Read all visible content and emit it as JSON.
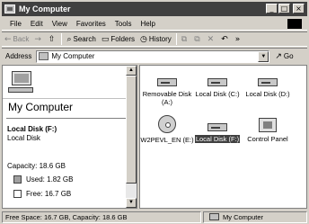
{
  "window": {
    "title": "My Computer"
  },
  "titlebar_buttons": {
    "minimize": "_",
    "maximize": "□",
    "close": "×"
  },
  "menu": [
    "File",
    "Edit",
    "View",
    "Favorites",
    "Tools",
    "Help"
  ],
  "toolbar": {
    "back": "Back",
    "back_icon": "←",
    "forward_icon": "→",
    "up_icon": "⇧",
    "search": "Search",
    "search_icon": "⌕",
    "folders": "Folders",
    "folders_icon": "▭",
    "history": "History",
    "history_icon": "◷",
    "move_icon": "⧉",
    "copy_icon": "⧉",
    "delete_icon": "✕",
    "undo_icon": "↶",
    "more_icon": "»"
  },
  "address": {
    "label": "Address",
    "value": "My Computer",
    "go": "Go",
    "go_icon": "↗"
  },
  "left_pane": {
    "heading": "My Computer",
    "selected_name": "Local Disk (F:)",
    "selected_type": "Local Disk",
    "capacity": "Capacity: 18.6 GB",
    "used": "Used: 1.82 GB",
    "free": "Free: 16.7 GB"
  },
  "items": [
    {
      "label": "Removable Disk (A:)",
      "icon": "floppy-drive-icon"
    },
    {
      "label": "Local Disk (C:)",
      "icon": "hard-drive-icon"
    },
    {
      "label": "Local Disk (D:)",
      "icon": "hard-drive-icon"
    },
    {
      "label": "W2PEVL_EN (E:)",
      "icon": "cd-drive-icon"
    },
    {
      "label": "Local Disk (F:)",
      "icon": "hard-drive-icon",
      "selected": true
    },
    {
      "label": "Control Panel",
      "icon": "control-panel-icon"
    }
  ],
  "status": {
    "left": "Free Space: 16.7 GB, Capacity: 18.6 GB",
    "right": "My Computer"
  },
  "colors": {
    "titlebar": "#404040",
    "selection": "#404040",
    "chrome": "#d4d0c8"
  }
}
